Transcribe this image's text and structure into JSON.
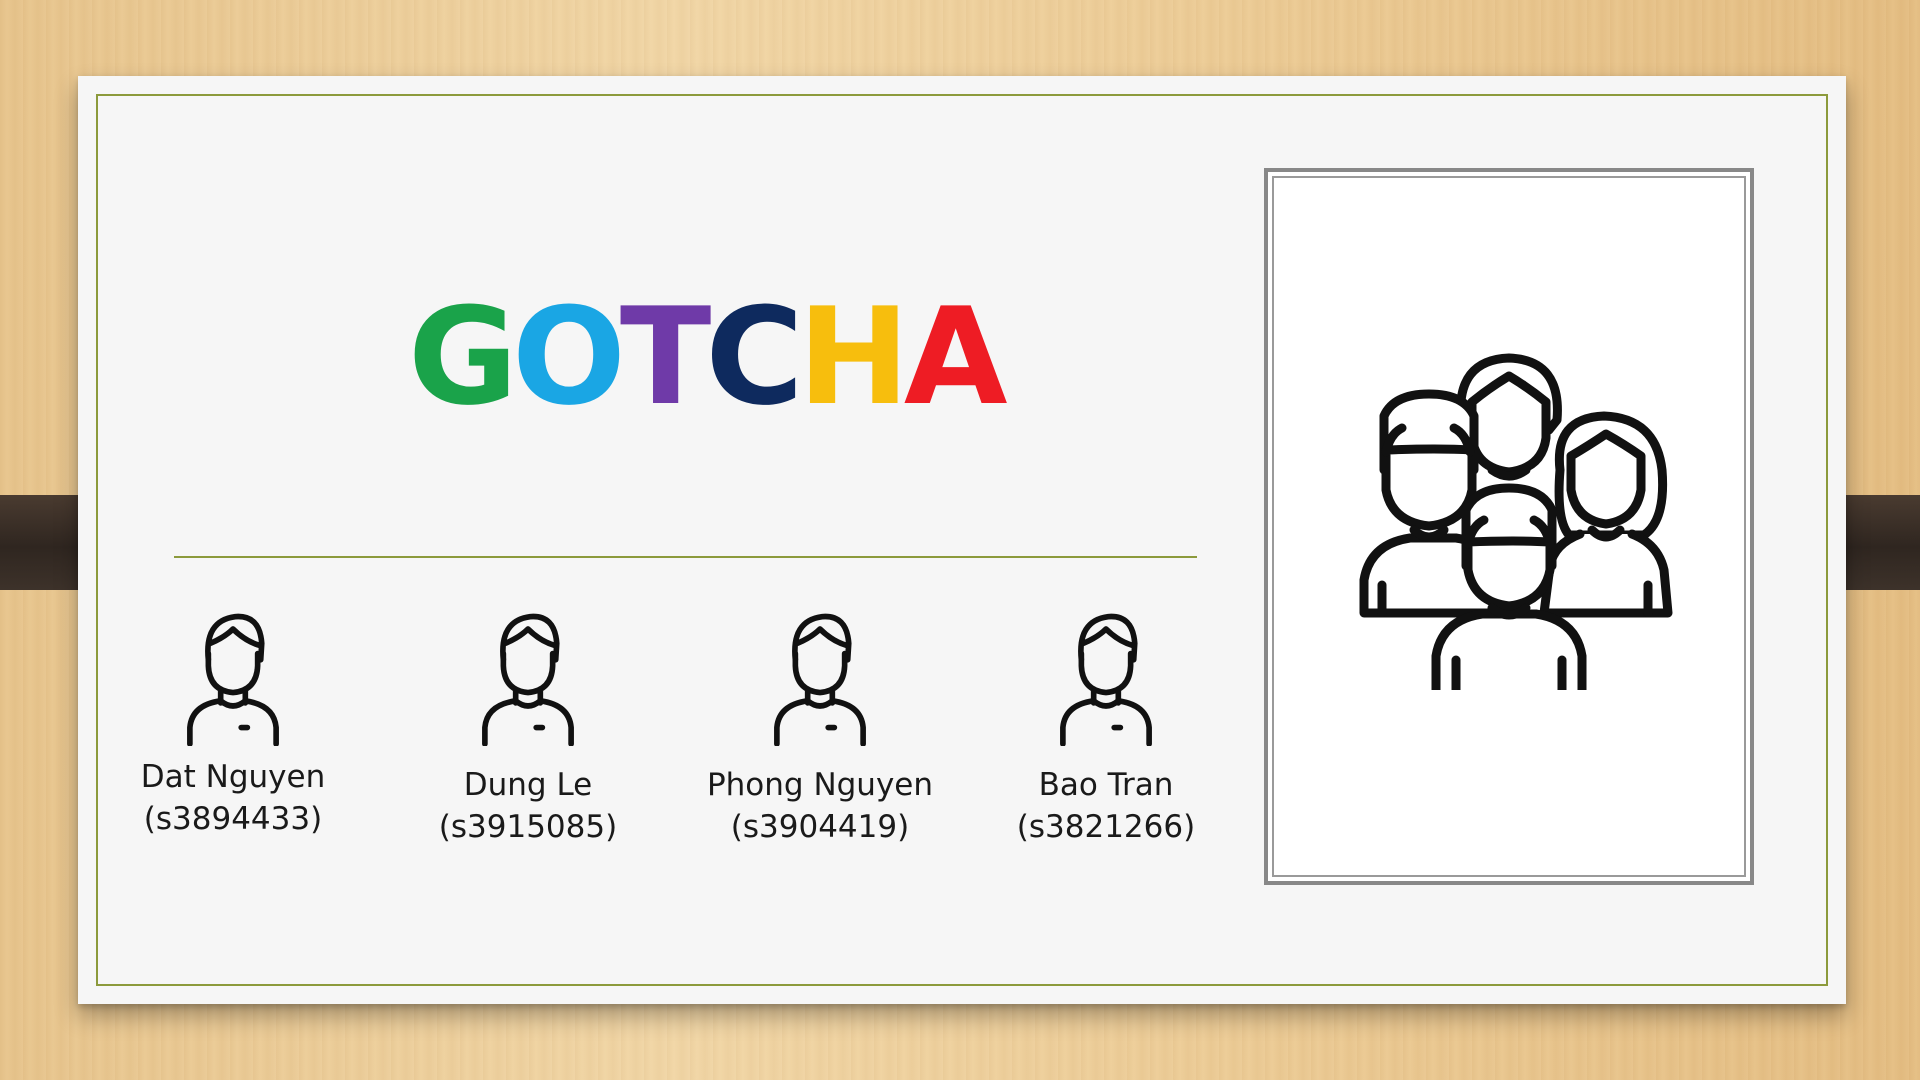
{
  "slide": {
    "logo": {
      "letters": [
        {
          "char": "G",
          "color": "#1aa34a"
        },
        {
          "char": "O",
          "color": "#1aa6e4"
        },
        {
          "char": "T",
          "color": "#6f3aa8"
        },
        {
          "char": "C",
          "color": "#0e2a5e"
        },
        {
          "char": "H",
          "color": "#f7be0d"
        },
        {
          "char": "A",
          "color": "#ee1c24"
        }
      ]
    },
    "members": [
      {
        "name": "Dat Nguyen",
        "student_id": "(s3894433)",
        "icon": "person-icon"
      },
      {
        "name": "Dung Le",
        "student_id": "(s3915085)",
        "icon": "person-icon"
      },
      {
        "name": "Phong Nguyen",
        "student_id": "(s3904419)",
        "icon": "person-icon"
      },
      {
        "name": "Bao Tran",
        "student_id": "(s3821266)",
        "icon": "person-icon"
      }
    ],
    "image": {
      "icon": "group-icon"
    },
    "colors": {
      "border": "#8c9a3c",
      "text": "#1a1a1a",
      "tape": "#3a2f28"
    }
  }
}
